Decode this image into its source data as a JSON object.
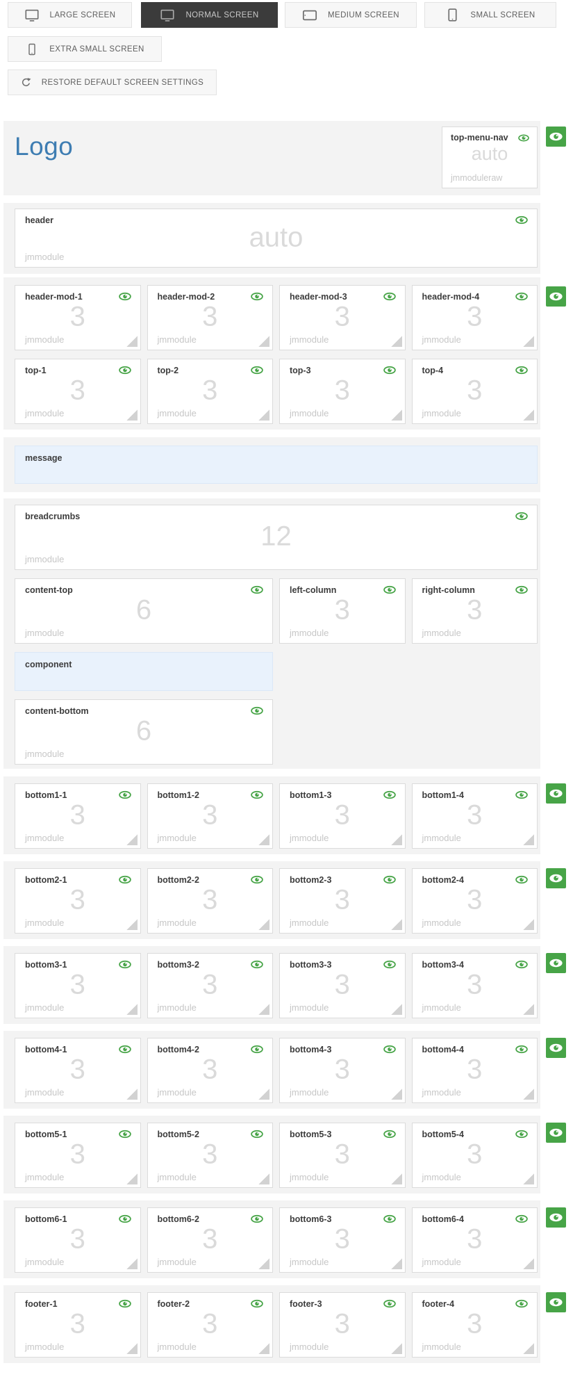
{
  "colors": {
    "accent_green": "#47a447",
    "logo_blue": "#3e7db2",
    "position_box_bg": "#e9f2fc",
    "active_button_bg": "#3b3b3b",
    "row_background": "#f3f3f3"
  },
  "icons": {
    "screen_large": "desktop-icon",
    "screen_normal": "desktop-icon",
    "screen_medium": "tablet-landscape-icon",
    "screen_small": "phone-icon",
    "screen_extra_small": "phone-small-icon",
    "restore": "restore-arrow-icon",
    "module_visibility": "eye-icon",
    "row_visibility": "eye-icon",
    "resize": "resize-handle"
  },
  "toolbar": {
    "screen_buttons": [
      {
        "label": "LARGE SCREEN",
        "active": false
      },
      {
        "label": "NORMAL SCREEN",
        "active": true
      },
      {
        "label": "MEDIUM SCREEN",
        "active": false
      },
      {
        "label": "SMALL SCREEN",
        "active": false
      },
      {
        "label": "EXTRA SMALL SCREEN",
        "active": false
      }
    ],
    "restore_label": "RESTORE DEFAULT SCREEN SETTINGS"
  },
  "layout": {
    "logo_text": "Logo",
    "top_menu_nav": {
      "title": "top-menu-nav",
      "size": "auto",
      "type": "jmmoduleraw"
    },
    "header": {
      "title": "header",
      "size": "auto",
      "type": "jmmodule"
    },
    "header_mods": [
      {
        "title": "header-mod-1",
        "size": "3",
        "type": "jmmodule"
      },
      {
        "title": "header-mod-2",
        "size": "3",
        "type": "jmmodule"
      },
      {
        "title": "header-mod-3",
        "size": "3",
        "type": "jmmodule"
      },
      {
        "title": "header-mod-4",
        "size": "3",
        "type": "jmmodule"
      }
    ],
    "tops": [
      {
        "title": "top-1",
        "size": "3",
        "type": "jmmodule"
      },
      {
        "title": "top-2",
        "size": "3",
        "type": "jmmodule"
      },
      {
        "title": "top-3",
        "size": "3",
        "type": "jmmodule"
      },
      {
        "title": "top-4",
        "size": "3",
        "type": "jmmodule"
      }
    ],
    "message_label": "message",
    "breadcrumbs": {
      "title": "breadcrumbs",
      "size": "12",
      "type": "jmmodule"
    },
    "content_top": {
      "title": "content-top",
      "size": "6",
      "type": "jmmodule"
    },
    "left_column": {
      "title": "left-column",
      "size": "3",
      "type": "jmmodule"
    },
    "right_column": {
      "title": "right-column",
      "size": "3",
      "type": "jmmodule"
    },
    "component_label": "component",
    "content_bottom": {
      "title": "content-bottom",
      "size": "6",
      "type": "jmmodule"
    },
    "bottom1": [
      {
        "title": "bottom1-1",
        "size": "3",
        "type": "jmmodule"
      },
      {
        "title": "bottom1-2",
        "size": "3",
        "type": "jmmodule"
      },
      {
        "title": "bottom1-3",
        "size": "3",
        "type": "jmmodule"
      },
      {
        "title": "bottom1-4",
        "size": "3",
        "type": "jmmodule"
      }
    ],
    "bottom2": [
      {
        "title": "bottom2-1",
        "size": "3",
        "type": "jmmodule"
      },
      {
        "title": "bottom2-2",
        "size": "3",
        "type": "jmmodule"
      },
      {
        "title": "bottom2-3",
        "size": "3",
        "type": "jmmodule"
      },
      {
        "title": "bottom2-4",
        "size": "3",
        "type": "jmmodule"
      }
    ],
    "bottom3": [
      {
        "title": "bottom3-1",
        "size": "3",
        "type": "jmmodule"
      },
      {
        "title": "bottom3-2",
        "size": "3",
        "type": "jmmodule"
      },
      {
        "title": "bottom3-3",
        "size": "3",
        "type": "jmmodule"
      },
      {
        "title": "bottom3-4",
        "size": "3",
        "type": "jmmodule"
      }
    ],
    "bottom4": [
      {
        "title": "bottom4-1",
        "size": "3",
        "type": "jmmodule"
      },
      {
        "title": "bottom4-2",
        "size": "3",
        "type": "jmmodule"
      },
      {
        "title": "bottom4-3",
        "size": "3",
        "type": "jmmodule"
      },
      {
        "title": "bottom4-4",
        "size": "3",
        "type": "jmmodule"
      }
    ],
    "bottom5": [
      {
        "title": "bottom5-1",
        "size": "3",
        "type": "jmmodule"
      },
      {
        "title": "bottom5-2",
        "size": "3",
        "type": "jmmodule"
      },
      {
        "title": "bottom5-3",
        "size": "3",
        "type": "jmmodule"
      },
      {
        "title": "bottom5-4",
        "size": "3",
        "type": "jmmodule"
      }
    ],
    "bottom6": [
      {
        "title": "bottom6-1",
        "size": "3",
        "type": "jmmodule"
      },
      {
        "title": "bottom6-2",
        "size": "3",
        "type": "jmmodule"
      },
      {
        "title": "bottom6-3",
        "size": "3",
        "type": "jmmodule"
      },
      {
        "title": "bottom6-4",
        "size": "3",
        "type": "jmmodule"
      }
    ],
    "footer": [
      {
        "title": "footer-1",
        "size": "3",
        "type": "jmmodule"
      },
      {
        "title": "footer-2",
        "size": "3",
        "type": "jmmodule"
      },
      {
        "title": "footer-3",
        "size": "3",
        "type": "jmmodule"
      },
      {
        "title": "footer-4",
        "size": "3",
        "type": "jmmodule"
      }
    ]
  }
}
